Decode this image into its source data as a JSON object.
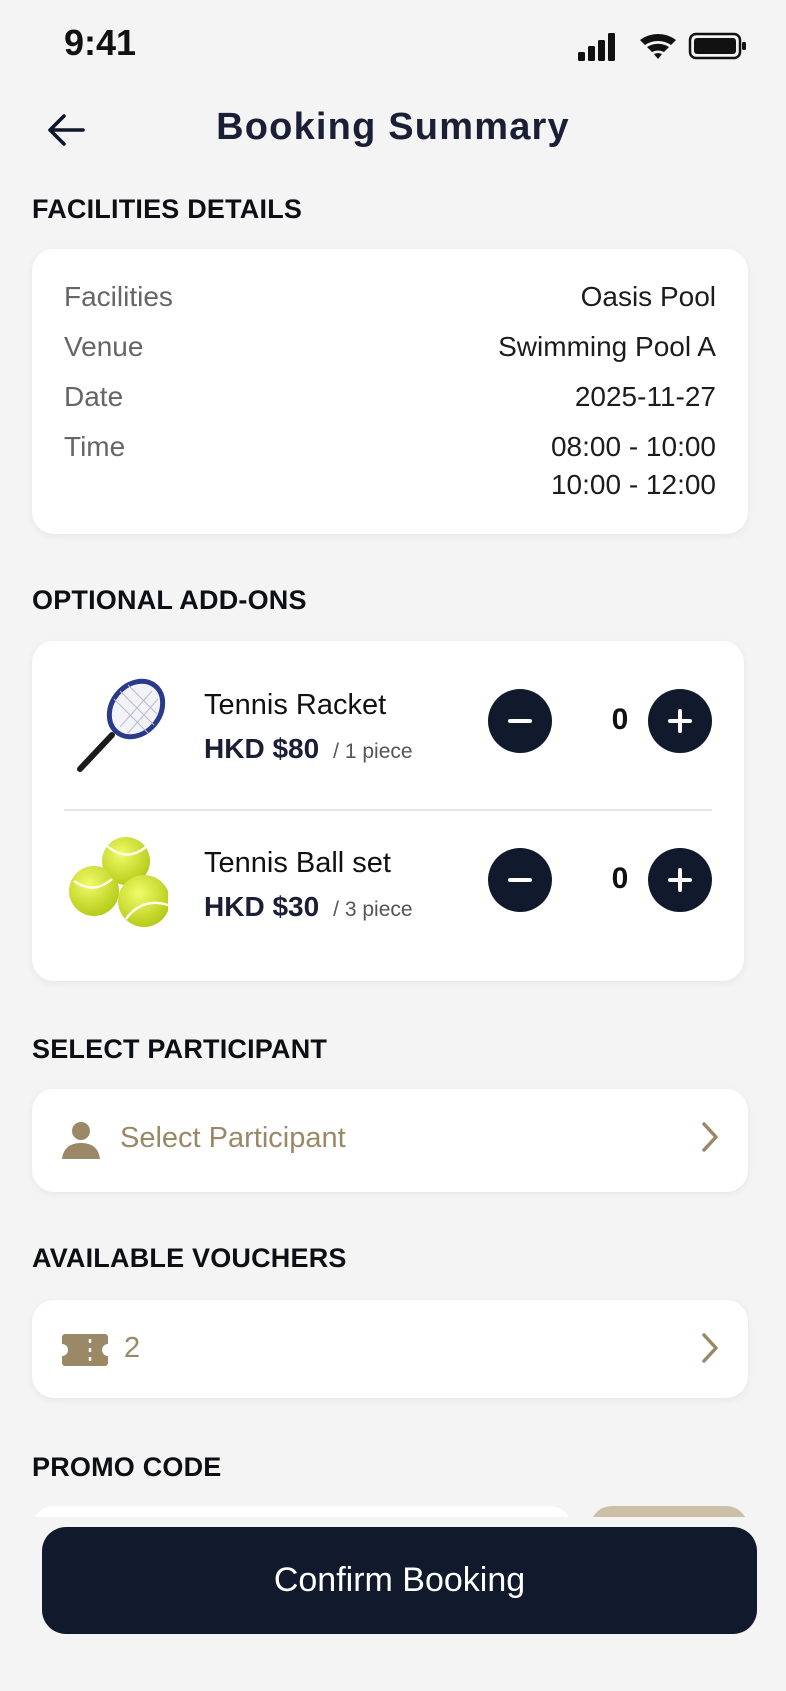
{
  "status_bar": {
    "time": "9:41"
  },
  "header": {
    "title": "Booking Summary"
  },
  "facilities_details": {
    "section_label": "FACILITIES DETAILS",
    "rows": [
      {
        "label": "Facilities",
        "value": "Oasis Pool"
      },
      {
        "label": "Venue",
        "value": "Swimming Pool A"
      },
      {
        "label": "Date",
        "value": "2025-11-27"
      },
      {
        "label": "Time",
        "value": "08:00 - 10:00",
        "value2": "10:00 - 12:00"
      }
    ]
  },
  "addons": {
    "section_label": "OPTIONAL ADD-ONS",
    "items": [
      {
        "name": "Tennis Racket",
        "price": "HKD $80",
        "unit": "/ 1 piece",
        "quantity": "0"
      },
      {
        "name": "Tennis Ball set",
        "price": "HKD $30",
        "unit": "/ 3 piece",
        "quantity": "0"
      }
    ]
  },
  "participant": {
    "section_label": "SELECT PARTICIPANT",
    "placeholder": "Select Participant"
  },
  "vouchers": {
    "section_label": "AVAILABLE VOUCHERS",
    "count": "2"
  },
  "promo": {
    "section_label": "PROMO CODE"
  },
  "footer": {
    "confirm_label": "Confirm Booking"
  },
  "colors": {
    "primary": "#111a2c",
    "accent": "#9a8866",
    "background": "#f4f4f4"
  }
}
